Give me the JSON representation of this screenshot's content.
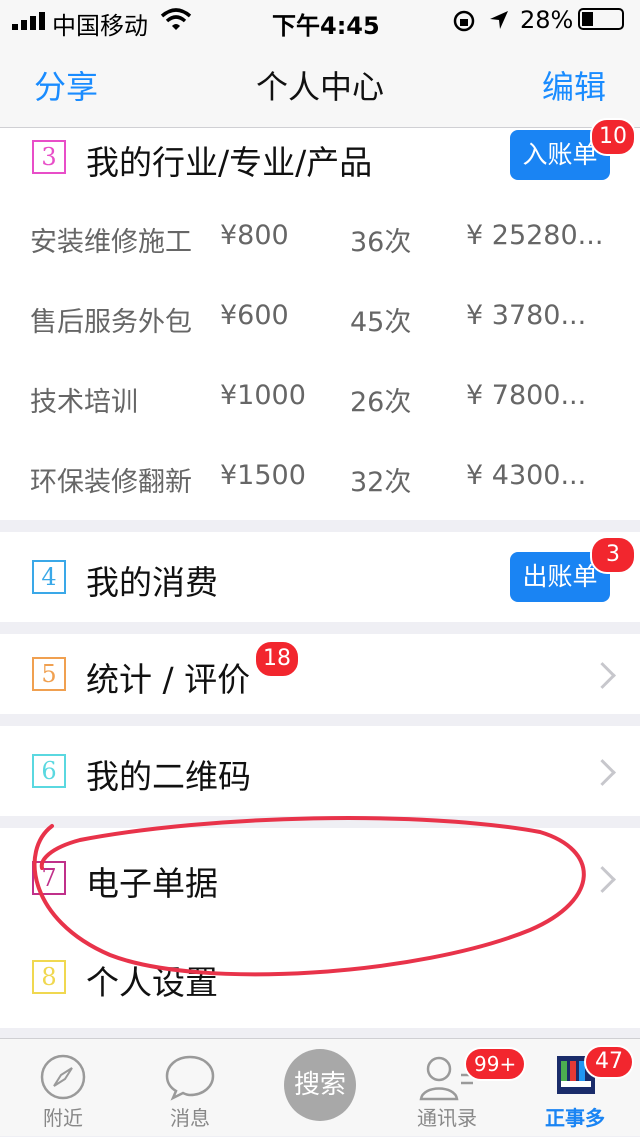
{
  "status": {
    "carrier": "中国移动",
    "time": "下午4:45",
    "battery": "28%"
  },
  "nav": {
    "left": "分享",
    "title": "个人中心",
    "right": "编辑"
  },
  "section3": {
    "num": "3",
    "title": "我的行业/专业/产品",
    "button": "入账单",
    "badge": "10",
    "rows": [
      {
        "name": "安装维修施工",
        "price": "¥800",
        "count": "36次",
        "total": "¥ 25280..."
      },
      {
        "name": "售后服务外包",
        "price": "¥600",
        "count": "45次",
        "total": "¥ 3780..."
      },
      {
        "name": "技术培训",
        "price": "¥1000",
        "count": "26次",
        "total": "¥ 7800..."
      },
      {
        "name": "环保装修翻新",
        "price": "¥1500",
        "count": "32次",
        "total": "¥ 4300..."
      }
    ]
  },
  "section4": {
    "num": "4",
    "title": "我的消费",
    "button": "出账单",
    "badge": "3"
  },
  "section5": {
    "num": "5",
    "title": "统计 / 评价",
    "badge": "18"
  },
  "section6": {
    "num": "6",
    "title": "我的二维码"
  },
  "section7": {
    "num": "7",
    "title": "电子单据"
  },
  "section8": {
    "num": "8",
    "title": "个人设置"
  },
  "tabs": {
    "nearby": "附近",
    "messages": "消息",
    "search": "搜索",
    "contacts": "通讯录",
    "contacts_badge": "99+",
    "app": "正事多",
    "app_badge": "47"
  },
  "colors": {
    "accent": "#1a84f3",
    "badge": "#f2262e",
    "annotation": "#e8334a"
  }
}
